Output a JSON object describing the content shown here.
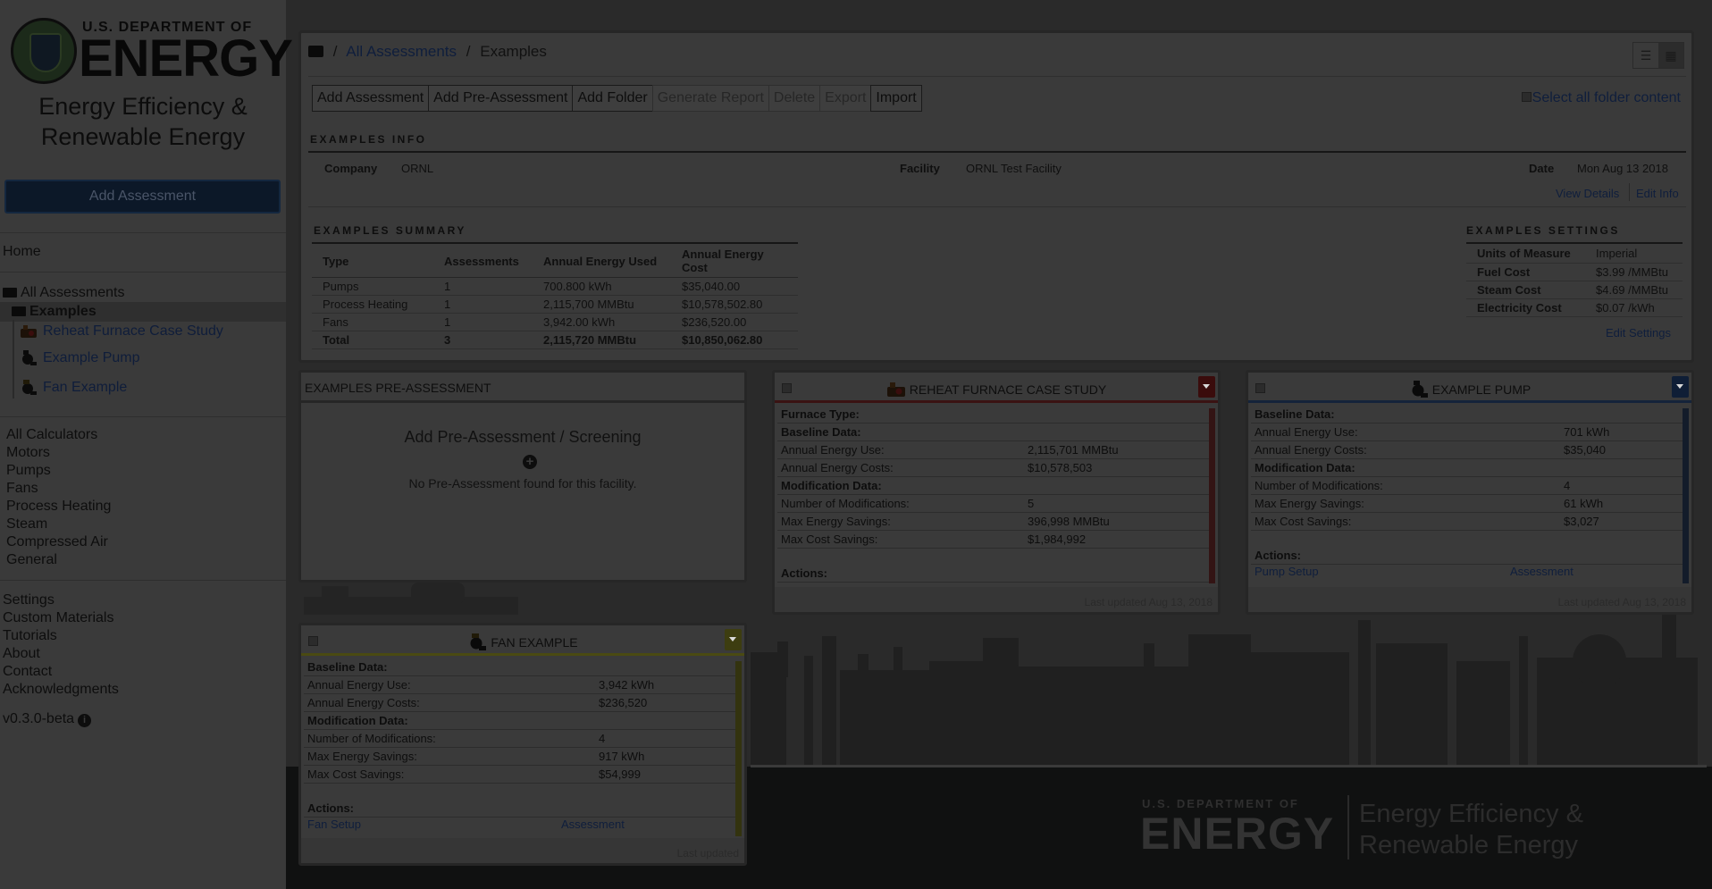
{
  "sidebar": {
    "logo": {
      "dept": "U.S. DEPARTMENT OF",
      "energy": "ENERGY",
      "subtitle_line1": "Energy Efficiency &",
      "subtitle_line2": "Renewable Energy"
    },
    "add_assessment": "Add Assessment",
    "home": "Home",
    "all_assessments": "All Assessments",
    "examples_folder": "Examples",
    "items": [
      "Reheat Furnace Case Study",
      "Example Pump",
      "Fan Example"
    ],
    "calculators": [
      "All Calculators",
      "Motors",
      "Pumps",
      "Fans",
      "Process Heating",
      "Steam",
      "Compressed Air",
      "General"
    ],
    "misc": [
      "Settings",
      "Custom Materials",
      "Tutorials",
      "About",
      "Contact",
      "Acknowledgments"
    ],
    "version": "v0.3.0-beta"
  },
  "breadcrumb": {
    "sep": "/",
    "all": "All Assessments",
    "current": "Examples"
  },
  "toolbar": [
    "Add Assessment",
    "Add Pre-Assessment",
    "Add Folder",
    "Generate Report",
    "Delete",
    "Export",
    "Import"
  ],
  "select_all": "Select all folder content",
  "info": {
    "title": "EXAMPLES INFO",
    "company_label": "Company",
    "company": "ORNL",
    "facility_label": "Facility",
    "facility": "ORNL Test Facility",
    "date_label": "Date",
    "date": "Mon Aug 13 2018",
    "view_details": "View Details",
    "edit_info": "Edit Info"
  },
  "summary": {
    "title": "EXAMPLES SUMMARY",
    "headers": [
      "Type",
      "Assessments",
      "Annual Energy Used",
      "Annual Energy Cost"
    ],
    "rows": [
      [
        "Pumps",
        "1",
        "700.800 kWh",
        "$35,040.00"
      ],
      [
        "Process Heating",
        "1",
        "2,115,700 MMBtu",
        "$10,578,502.80"
      ],
      [
        "Fans",
        "1",
        "3,942.00 kWh",
        "$236,520.00"
      ],
      [
        "Total",
        "3",
        "2,115,720 MMBtu",
        "$10,850,062.80"
      ]
    ]
  },
  "settings": {
    "title": "EXAMPLES SETTINGS",
    "rows": [
      [
        "Units of Measure",
        "Imperial"
      ],
      [
        "Fuel Cost",
        "$3.99 /MMBtu"
      ],
      [
        "Steam Cost",
        "$4.69 /MMBtu"
      ],
      [
        "Electricity Cost",
        "$0.07 /kWh"
      ]
    ],
    "edit": "Edit Settings"
  },
  "pre_assessment": {
    "title": "EXAMPLES PRE-ASSESSMENT",
    "add": "Add Pre-Assessment / Screening",
    "plus": "+",
    "none": "No Pre-Assessment found for this facility."
  },
  "cards": {
    "furnace": {
      "title": "REHEAT FURNACE CASE STUDY",
      "furnace_type": "Furnace Type:",
      "baseline": "Baseline Data:",
      "use_label": "Annual Energy Use:",
      "use": "2,115,701 MMBtu",
      "cost_label": "Annual Energy Costs:",
      "cost": "$10,578,503",
      "mod": "Modification Data:",
      "n_label": "Number of Modifications:",
      "n": "5",
      "es_label": "Max Energy Savings:",
      "es": "396,998 MMBtu",
      "cs_label": "Max Cost Savings:",
      "cs": "$1,984,992",
      "actions": "Actions:",
      "updated": "Last updated Aug 13, 2018"
    },
    "pump": {
      "title": "EXAMPLE PUMP",
      "baseline": "Baseline Data:",
      "use_label": "Annual Energy Use:",
      "use": "701 kWh",
      "cost_label": "Annual Energy Costs:",
      "cost": "$35,040",
      "mod": "Modification Data:",
      "n_label": "Number of Modifications:",
      "n": "4",
      "es_label": "Max Energy Savings:",
      "es": "61 kWh",
      "cs_label": "Max Cost Savings:",
      "cs": "$3,027",
      "actions": "Actions:",
      "setup": "Pump Setup",
      "assessment": "Assessment",
      "updated": "Last updated Aug 13, 2018"
    },
    "fan": {
      "title": "FAN EXAMPLE",
      "baseline": "Baseline Data:",
      "use_label": "Annual Energy Use:",
      "use": "3,942 kWh",
      "cost_label": "Annual Energy Costs:",
      "cost": "$236,520",
      "mod": "Modification Data:",
      "n_label": "Number of Modifications:",
      "n": "4",
      "es_label": "Max Energy Savings:",
      "es": "917 kWh",
      "cs_label": "Max Cost Savings:",
      "cs": "$54,999",
      "actions": "Actions:",
      "setup": "Fan Setup",
      "assessment": "Assessment",
      "updated": "Last updated"
    }
  },
  "footer": {
    "dept": "U.S. DEPARTMENT OF",
    "energy": "ENERGY",
    "sub1": "Energy Efficiency &",
    "sub2": "Renewable Energy"
  },
  "colors": {
    "overlay_bg": "#2a2a2a",
    "furnace_accent": "#3a1212",
    "pump_accent": "#14233a",
    "fan_accent": "#4a4a12"
  },
  "icons": [
    "folder-icon",
    "list-view-icon",
    "grid-view-icon",
    "furnace-icon",
    "pump-icon",
    "fan-icon",
    "info-icon",
    "plus-circle-icon",
    "chevron-down-icon"
  ]
}
